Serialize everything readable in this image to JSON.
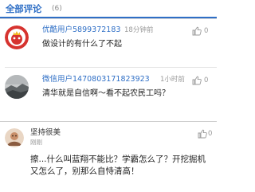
{
  "header": {
    "title": "全部评论",
    "count": "(6)"
  },
  "comments": [
    {
      "username": "优酷用户5899372183",
      "time": "18分钟前",
      "likes": "0",
      "text": "做设计的有什么了不起"
    },
    {
      "username": "微信用户1470803171823923",
      "time": "1小时前",
      "likes": "0",
      "text": "清华就是自信啊～看不起农民工吗？"
    }
  ],
  "bottom_comment": {
    "username": "坚持很美",
    "time": "刚刚",
    "likes": "0",
    "text": "擦...什么叫蓝翔不能比？学霸怎么了？开挖掘机又怎么了，别那么自恃清高！"
  },
  "colors": {
    "accent": "#2f6fc6",
    "text": "#222222",
    "muted": "#9a9a9a"
  },
  "icons": {
    "like": "thumbs-up-icon"
  }
}
